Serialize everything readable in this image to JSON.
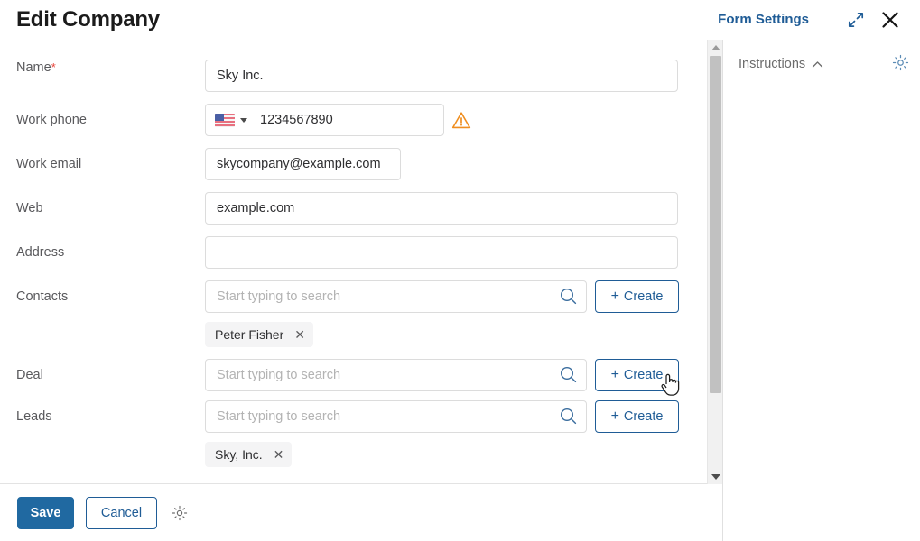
{
  "header": {
    "title": "Edit Company",
    "form_settings_label": "Form Settings",
    "expand_icon": "expand-arrows-icon",
    "close_icon": "close-icon"
  },
  "right_panel": {
    "instructions_label": "Instructions",
    "collapse_icon": "chevron-up-icon",
    "settings_icon": "gear-icon"
  },
  "form": {
    "fields": [
      {
        "label": "Name",
        "required": true,
        "type": "text",
        "value": "Sky Inc.",
        "placeholder": ""
      },
      {
        "label": "Work phone",
        "required": false,
        "type": "phone",
        "value": "1234567890",
        "placeholder": "",
        "country_flag": "us-flag-icon",
        "warning_icon": "warning-triangle-icon"
      },
      {
        "label": "Work email",
        "required": false,
        "type": "text",
        "value": "skycompany@example.com",
        "placeholder": ""
      },
      {
        "label": "Web",
        "required": false,
        "type": "text",
        "value": "example.com",
        "placeholder": ""
      },
      {
        "label": "Address",
        "required": false,
        "type": "text",
        "value": "",
        "placeholder": ""
      },
      {
        "label": "Contacts",
        "required": false,
        "type": "lookup",
        "value": "",
        "placeholder": "Start typing to search",
        "create_label": "Create",
        "search_icon": "search-icon",
        "chips": [
          {
            "label": "Peter Fisher",
            "remove_icon": "close-icon"
          }
        ]
      },
      {
        "label": "Deal",
        "required": false,
        "type": "lookup",
        "value": "",
        "placeholder": "Start typing to search",
        "create_label": "Create",
        "search_icon": "search-icon",
        "chips": []
      },
      {
        "label": "Leads",
        "required": false,
        "type": "lookup",
        "value": "",
        "placeholder": "Start typing to search",
        "create_label": "Create",
        "search_icon": "search-icon",
        "chips": [
          {
            "label": "Sky, Inc.",
            "remove_icon": "close-icon"
          }
        ]
      }
    ]
  },
  "footer": {
    "save_label": "Save",
    "cancel_label": "Cancel",
    "settings_icon": "gear-icon"
  },
  "scrollbar": {
    "up_icon": "triangle-up-icon",
    "down_icon": "triangle-down-icon"
  },
  "colors": {
    "accent_blue": "#1f5c96",
    "save_blue": "#2069a1",
    "required_red": "#e8453c",
    "warning_orange": "#ef8e20",
    "chip_bg": "#f4f4f5",
    "border_grey": "#dcdcdc"
  },
  "cursor": {
    "type": "pointer-hand-cursor"
  }
}
